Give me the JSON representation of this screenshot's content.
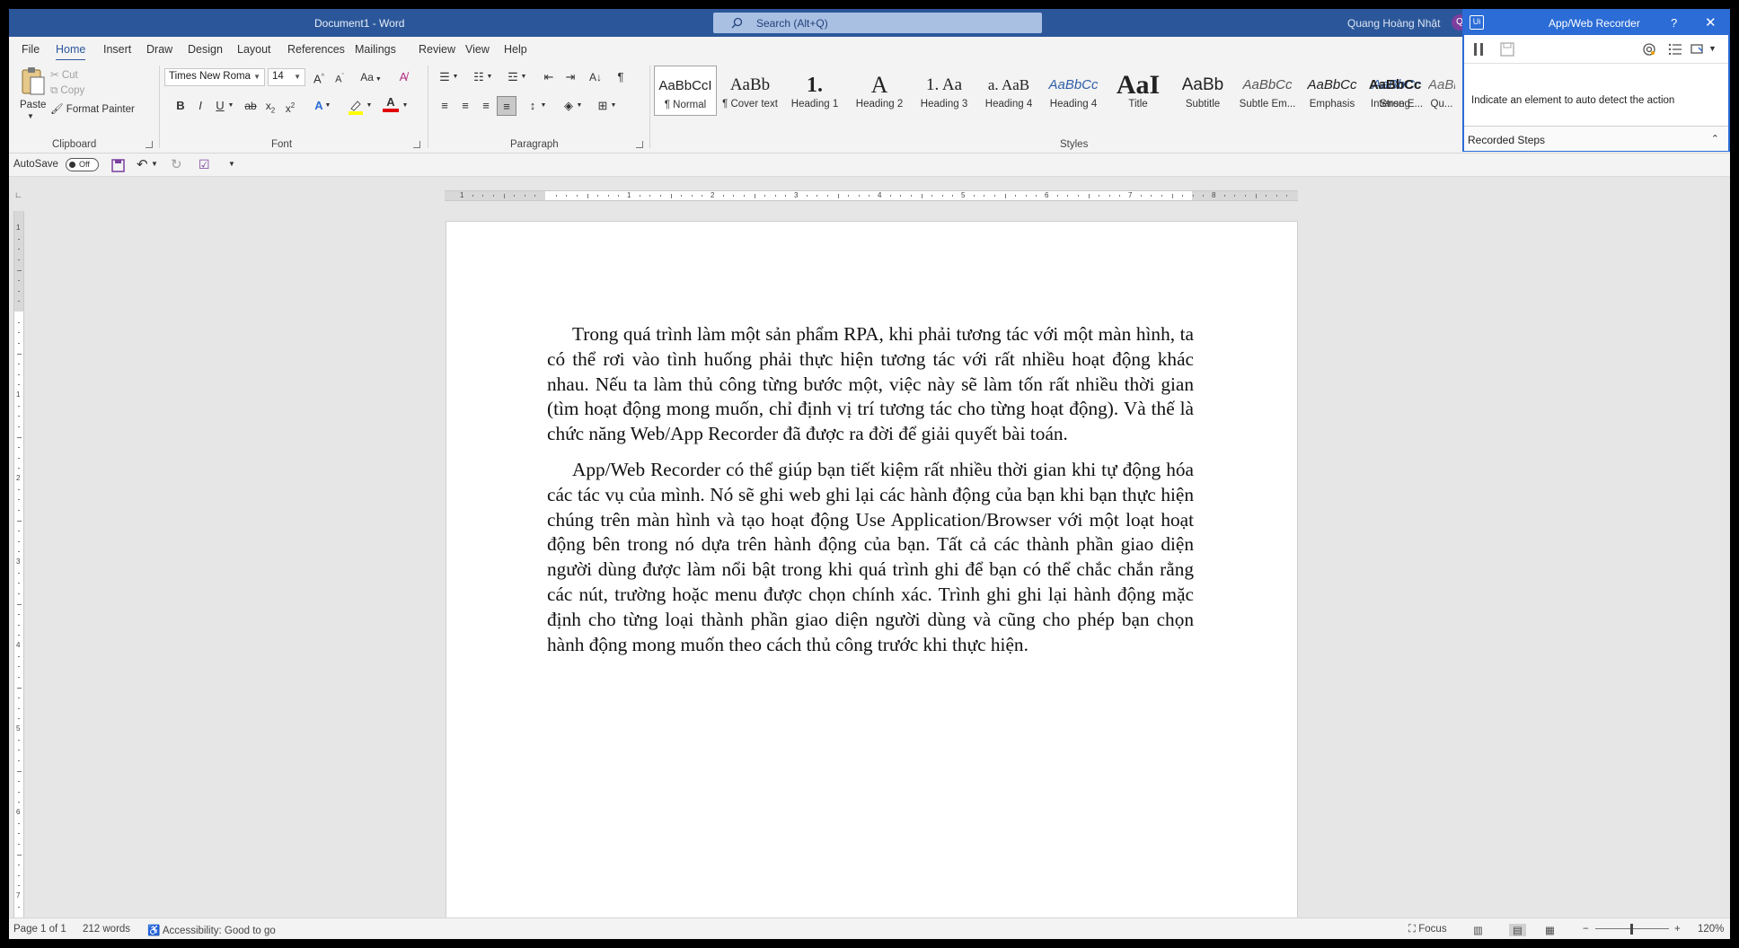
{
  "window": {
    "doc_title": "Document1  -  Word",
    "search_placeholder": "Search (Alt+Q)",
    "user_name": "Quang Hoàng Nhật",
    "user_initials": "Q"
  },
  "tabs": [
    "File",
    "Home",
    "Insert",
    "Draw",
    "Design",
    "Layout",
    "References",
    "Mailings",
    "Review",
    "View",
    "Help"
  ],
  "active_tab": "Home",
  "clipboard": {
    "paste": "Paste",
    "cut": "Cut",
    "copy": "Copy",
    "format_painter": "Format Painter",
    "label": "Clipboard"
  },
  "font": {
    "name": "Times New Roma",
    "size": "14",
    "label": "Font",
    "change_case": "Aa"
  },
  "paragraph": {
    "label": "Paragraph"
  },
  "styles": {
    "label": "Styles",
    "items": [
      {
        "preview": "AaBbCcI",
        "name": "¶ Normal"
      },
      {
        "preview": "AaBb",
        "name": "¶ Cover text"
      },
      {
        "preview": "1.",
        "name": "Heading 1"
      },
      {
        "preview": "A",
        "name": "Heading 2"
      },
      {
        "preview": "1.  Aa",
        "name": "Heading 3"
      },
      {
        "preview": "a.  AaB",
        "name": "Heading 4"
      },
      {
        "preview": "AaBbCc",
        "name": "Title"
      },
      {
        "preview": "AaI",
        "name": "Subtitle"
      },
      {
        "preview": "AaBb",
        "name": "Subtle Em..."
      },
      {
        "preview": "AaBbCc",
        "name": "Emphasis"
      },
      {
        "preview": "AaBbCc",
        "name": "Intense E..."
      },
      {
        "preview": "AaBbCc",
        "name": "Strong"
      },
      {
        "preview": "AaBbCc",
        "name": "Qu..."
      }
    ]
  },
  "qat": {
    "autosave": "AutoSave",
    "toggle": "Off"
  },
  "document": {
    "paragraphs": [
      "Trong quá trình làm một sản phẩm RPA, khi phải tương tác với một màn hình, ta có thể rơi vào tình huống phải thực hiện tương tác với rất nhiều hoạt động khác nhau. Nếu ta làm thủ công từng bước một, việc này sẽ làm tốn rất nhiều thời gian (tìm hoạt động mong muốn, chỉ định vị trí tương tác cho từng hoạt động). Và thế là chức năng Web/App Recorder đã được ra đời để giải quyết bài toán.",
      "App/Web Recorder có thể giúp bạn tiết kiệm rất nhiều thời gian khi tự động hóa các tác vụ của mình. Nó sẽ ghi web ghi lại các hành động của bạn khi bạn thực hiện chúng trên màn hình và tạo hoạt động Use Application/Browser với một loạt hoạt động bên trong nó dựa trên hành động của bạn. Tất cả các thành phần giao diện người dùng được làm nổi bật trong khi quá trình ghi để bạn có thể chắc chắn rằng các nút, trường hoặc menu được chọn chính xác. Trình ghi ghi lại hành động mặc định cho từng loại thành phần giao diện người dùng và cũng cho phép bạn chọn hành động mong muốn theo cách thủ công trước khi thực hiện."
    ]
  },
  "status": {
    "page": "Page 1 of 1",
    "words": "212 words",
    "accessibility": "Accessibility: Good to go",
    "focus": "Focus",
    "zoom": "120%"
  },
  "recorder": {
    "title": "App/Web Recorder",
    "help": "?",
    "hint": "Indicate an element to auto detect the action",
    "steps_label": "Recorded Steps"
  },
  "colors": {
    "word_blue": "#2b579a",
    "recorder_blue": "#2b6cd6",
    "highlight": "#ffff00",
    "font_color": "#e00000"
  }
}
